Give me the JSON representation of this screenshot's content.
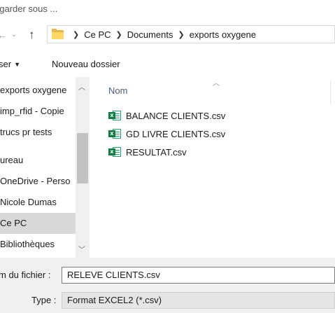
{
  "window": {
    "title": "egarder sous ..."
  },
  "address": {
    "crumbs": [
      "Ce PC",
      "Documents",
      "exports oxygene"
    ]
  },
  "toolbar": {
    "organize_label": "ser",
    "new_folder_label": "Nouveau dossier"
  },
  "nav": {
    "items": [
      {
        "label": "exports oxygene"
      },
      {
        "label": "imp_rfid - Copie"
      },
      {
        "label": "trucs pr tests"
      },
      {
        "label": "ureau"
      },
      {
        "label": "OneDrive - Perso"
      },
      {
        "label": "Nicole Dumas"
      },
      {
        "label": "Ce PC"
      },
      {
        "label": "Bibliothèques"
      }
    ]
  },
  "main": {
    "column_name": "Nom",
    "files": [
      {
        "name": "BALANCE CLIENTS.csv",
        "icon": "excel-csv-icon"
      },
      {
        "name": "GD LIVRE CLIENTS.csv",
        "icon": "excel-csv-icon"
      },
      {
        "name": "RESULTAT.csv",
        "icon": "excel-csv-icon"
      }
    ]
  },
  "form": {
    "filename_label": "m du fichier :",
    "filename_value": "RELEVE CLIENTS.csv",
    "type_label": "Type :",
    "type_value": "Format EXCEL2 (*.csv)"
  },
  "colors": {
    "folder": "#ffd764",
    "excel": "#107c41",
    "selection": "#d9d9d9",
    "panel": "#f0f0f0"
  }
}
